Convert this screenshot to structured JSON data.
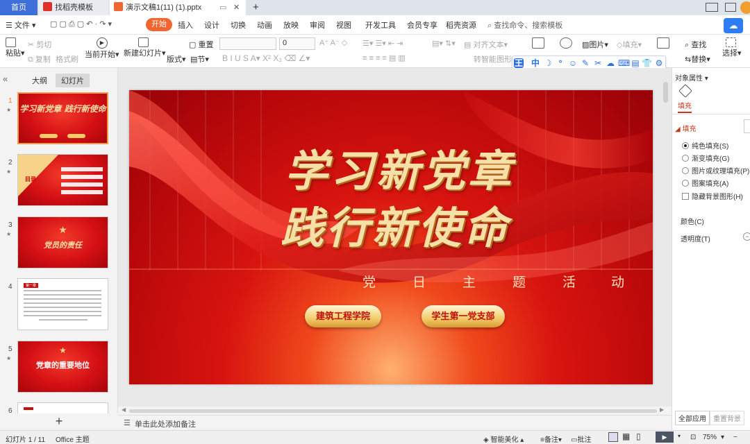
{
  "tabs": {
    "home": "首页",
    "template": "找稻壳模板",
    "document": "演示文稿1(11) (1).pptx",
    "new_tab": "+"
  },
  "menu": {
    "file": "文件",
    "start": "开始",
    "items": [
      "插入",
      "设计",
      "切换",
      "动画",
      "放映",
      "审阅",
      "视图",
      "开发工具",
      "会员专享",
      "稻壳资源"
    ],
    "search": "查找命令、搜索模板"
  },
  "ribbon": {
    "paste": "粘贴",
    "cut": "剪切",
    "copy": "复制",
    "format_painter": "格式刷",
    "from_current": "当前开始",
    "new_slide": "新建幻灯片",
    "layout": "版式",
    "section": "节",
    "reset": "重置",
    "font_size": "0",
    "align_text": "对齐文本",
    "to_smartart": "转智能图形",
    "picture": "图片",
    "fill": "填充",
    "find": "查找",
    "replace": "替换",
    "select": "选择"
  },
  "float_toolbar": [
    "王",
    "中",
    "☽",
    "°",
    "☺",
    "✎",
    "✂",
    "☁",
    "⌨",
    "▤",
    "👕",
    "⚙"
  ],
  "left_panel": {
    "tab_outline": "大纲",
    "tab_slides": "幻灯片",
    "thumbs": [
      {
        "num": "1",
        "text": "学习新党章 践行新使命"
      },
      {
        "num": "2",
        "text": "目录"
      },
      {
        "num": "3",
        "text": "党员的责任"
      },
      {
        "num": "4",
        "text": "第一章"
      },
      {
        "num": "5",
        "text": "党章的重要地位"
      },
      {
        "num": "6",
        "text": ""
      }
    ],
    "add": "+"
  },
  "slide": {
    "title_line1": "学习新党章",
    "title_line2": "践行新使命",
    "subtitle_chars": [
      "党",
      "日",
      "主",
      "题",
      "活",
      "动"
    ],
    "button1": "建筑工程学院",
    "button2": "学生第一党支部"
  },
  "right_panel": {
    "header": "对象属性",
    "tab": "填充",
    "section": "填充",
    "options": [
      "纯色填充(S)",
      "渐变填充(G)",
      "图片或纹理填充(P)",
      "图案填充(A)"
    ],
    "hide_bg": "隐藏背景图形(H)",
    "color": "颜色(C)",
    "transparency": "透明度(T)",
    "apply_all": "全部应用",
    "reset_bg": "重置背景"
  },
  "notes": {
    "placeholder": "单击此处添加备注"
  },
  "status": {
    "slide_pos": "幻灯片 1 / 11",
    "theme": "Office 主题",
    "smart_beautify": "智能美化",
    "notes": "备注",
    "comments": "批注",
    "zoom": "75%"
  },
  "colors": {
    "accent": "#f06530",
    "home_tab": "#3f6fd8",
    "slide_red": "#d8140f",
    "gold": "#f7e0a8"
  }
}
